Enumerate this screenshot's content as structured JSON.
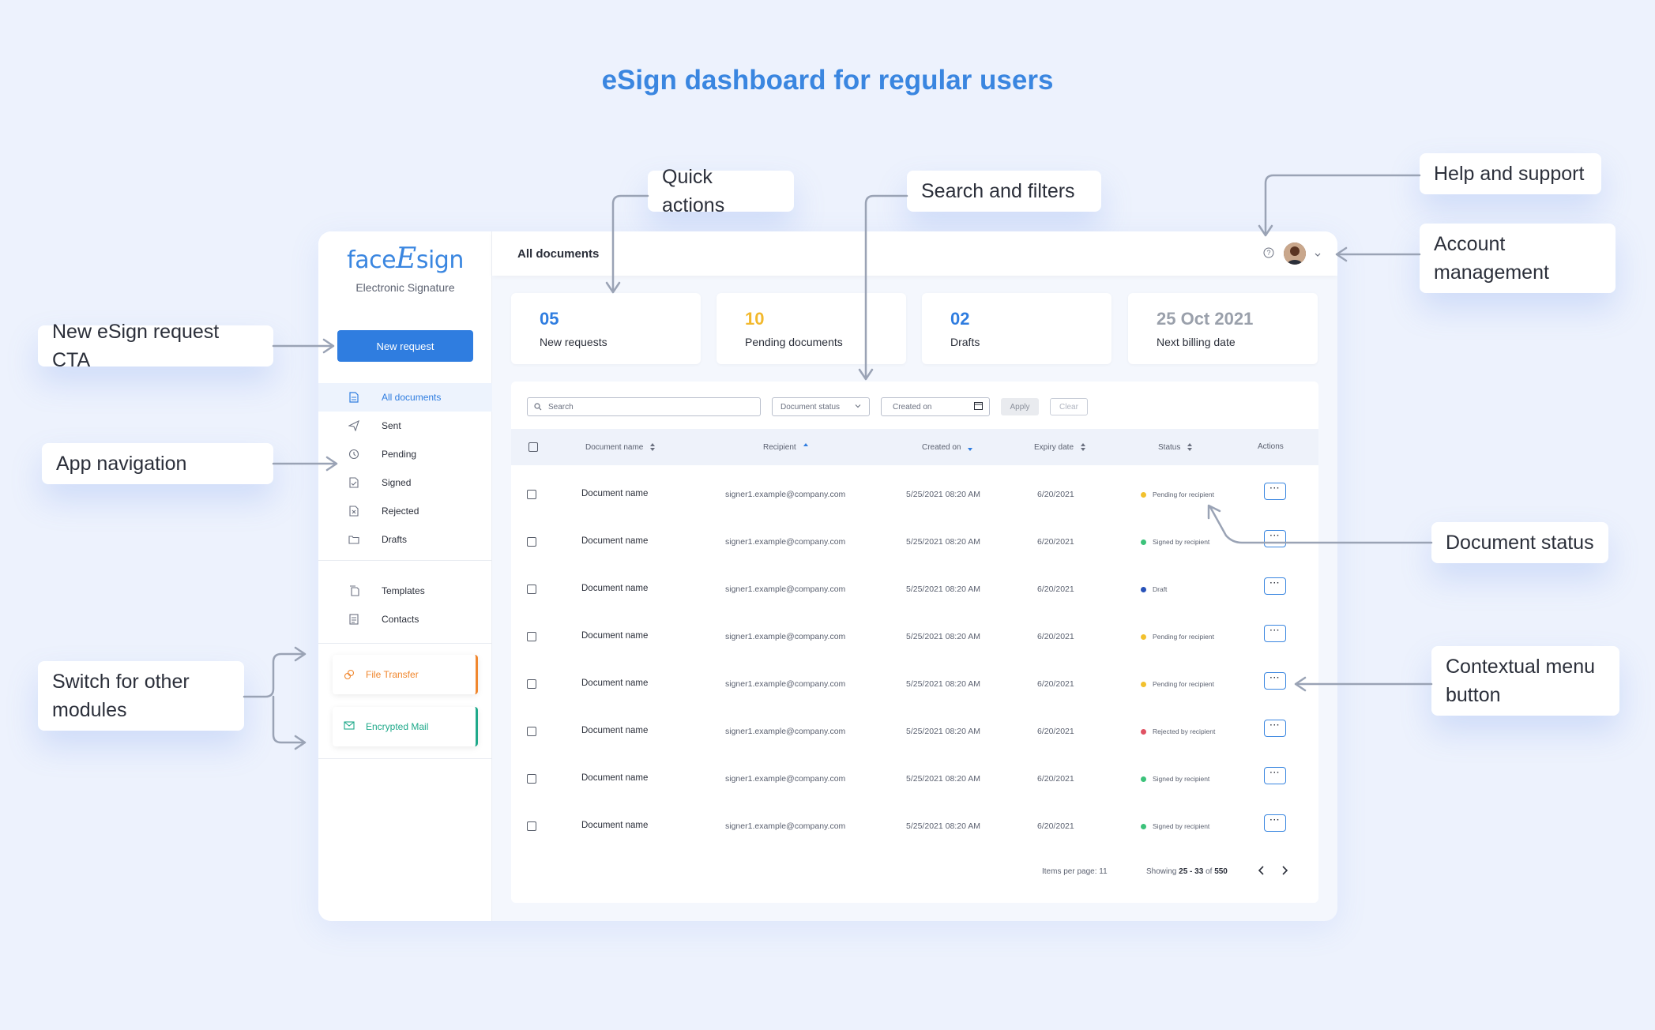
{
  "page_title": "eSign dashboard for regular users",
  "callouts": {
    "quick_actions": "Quick actions",
    "search_filters": "Search and filters",
    "help_support": "Help and support",
    "account_management": "Account management",
    "new_request_cta": "New eSign request CTA",
    "app_navigation": "App navigation",
    "document_status": "Document status",
    "switch_modules": "Switch for other modules",
    "contextual_menu": "Contextual menu button"
  },
  "sidebar": {
    "logo_a": "face",
    "logo_b": "E",
    "logo_c": "sign",
    "logo_sub": "Electronic Signature",
    "new_request": "New request",
    "items": [
      {
        "label": "All documents",
        "icon": "document-icon"
      },
      {
        "label": "Sent",
        "icon": "send-icon"
      },
      {
        "label": "Pending",
        "icon": "clock-icon"
      },
      {
        "label": "Signed",
        "icon": "signed-doc-icon"
      },
      {
        "label": "Rejected",
        "icon": "rejected-doc-icon"
      },
      {
        "label": "Drafts",
        "icon": "folder-icon"
      }
    ],
    "items2": [
      {
        "label": "Templates",
        "icon": "templates-icon"
      },
      {
        "label": "Contacts",
        "icon": "contacts-icon"
      }
    ],
    "modules": [
      {
        "label": "File Transfer",
        "color": "#f0872e",
        "icon": "file-transfer-icon"
      },
      {
        "label": "Encrypted Mail",
        "color": "#1fa98a",
        "icon": "encrypted-mail-icon"
      }
    ]
  },
  "topbar": {
    "title": "All documents"
  },
  "stats": [
    {
      "value": "05",
      "label": "New requests",
      "color": "#2f7de0"
    },
    {
      "value": "10",
      "label": "Pending documents",
      "color": "#f2b82c"
    },
    {
      "value": "02",
      "label": "Drafts",
      "color": "#2f7de0"
    },
    {
      "value": "25 Oct 2021",
      "label": "Next billing date",
      "color": "#9aa0ab"
    }
  ],
  "filters": {
    "search_placeholder": "Search",
    "document_status": "Document status",
    "created_on": "Created on",
    "apply": "Apply",
    "clear": "Clear"
  },
  "table": {
    "headers": {
      "name": "Document name",
      "recipient": "Recipient",
      "created": "Created on",
      "expiry": "Expiry date",
      "status": "Status",
      "actions": "Actions"
    },
    "rows": [
      {
        "name": "Document name",
        "recipient": "signer1.example@company.com",
        "created": "5/25/2021 08:20 AM",
        "expiry": "6/20/2021",
        "status": "Pending for recipient",
        "status_color": "#f2c12e"
      },
      {
        "name": "Document name",
        "recipient": "signer1.example@company.com",
        "created": "5/25/2021 08:20 AM",
        "expiry": "6/20/2021",
        "status": "Signed by recipient",
        "status_color": "#3cc27a"
      },
      {
        "name": "Document name",
        "recipient": "signer1.example@company.com",
        "created": "5/25/2021 08:20 AM",
        "expiry": "6/20/2021",
        "status": "Draft",
        "status_color": "#2852b8"
      },
      {
        "name": "Document name",
        "recipient": "signer1.example@company.com",
        "created": "5/25/2021 08:20 AM",
        "expiry": "6/20/2021",
        "status": "Pending for recipient",
        "status_color": "#f2c12e"
      },
      {
        "name": "Document name",
        "recipient": "signer1.example@company.com",
        "created": "5/25/2021 08:20 AM",
        "expiry": "6/20/2021",
        "status": "Pending for recipient",
        "status_color": "#f2c12e"
      },
      {
        "name": "Document name",
        "recipient": "signer1.example@company.com",
        "created": "5/25/2021 08:20 AM",
        "expiry": "6/20/2021",
        "status": "Rejected by recipient",
        "status_color": "#e05263"
      },
      {
        "name": "Document name",
        "recipient": "signer1.example@company.com",
        "created": "5/25/2021 08:20 AM",
        "expiry": "6/20/2021",
        "status": "Signed by recipient",
        "status_color": "#3cc27a"
      },
      {
        "name": "Document name",
        "recipient": "signer1.example@company.com",
        "created": "5/25/2021 08:20 AM",
        "expiry": "6/20/2021",
        "status": "Signed by recipient",
        "status_color": "#3cc27a"
      }
    ],
    "action_label": "···"
  },
  "pagination": {
    "items_per_page": "Items per page: 11",
    "showing_prefix": "Showing",
    "showing_range": "25 - 33",
    "showing_of": "of",
    "showing_total": "550"
  }
}
